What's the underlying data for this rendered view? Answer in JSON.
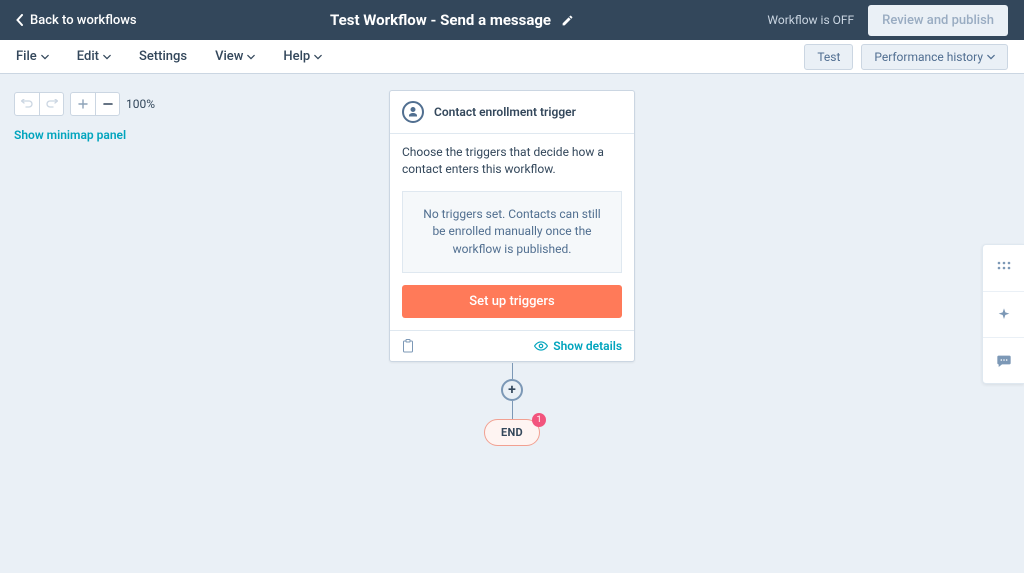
{
  "topbar": {
    "back_label": "Back to workflows",
    "title": "Test Workflow - Send a message",
    "status_label": "Workflow is OFF",
    "publish_label": "Review and publish"
  },
  "menubar": {
    "items": [
      "File",
      "Edit",
      "Settings",
      "View",
      "Help"
    ],
    "test_label": "Test",
    "history_label": "Performance history"
  },
  "toolbox": {
    "zoom_label": "100%",
    "minimap_link": "Show minimap panel"
  },
  "trigger_card": {
    "title": "Contact enrollment trigger",
    "description": "Choose the triggers that decide how a contact enters this workflow.",
    "empty_text": "No triggers set. Contacts can still be enrolled manually once the workflow is published.",
    "setup_label": "Set up triggers",
    "details_label": "Show details"
  },
  "end_node": {
    "label": "END",
    "badge": "1"
  }
}
